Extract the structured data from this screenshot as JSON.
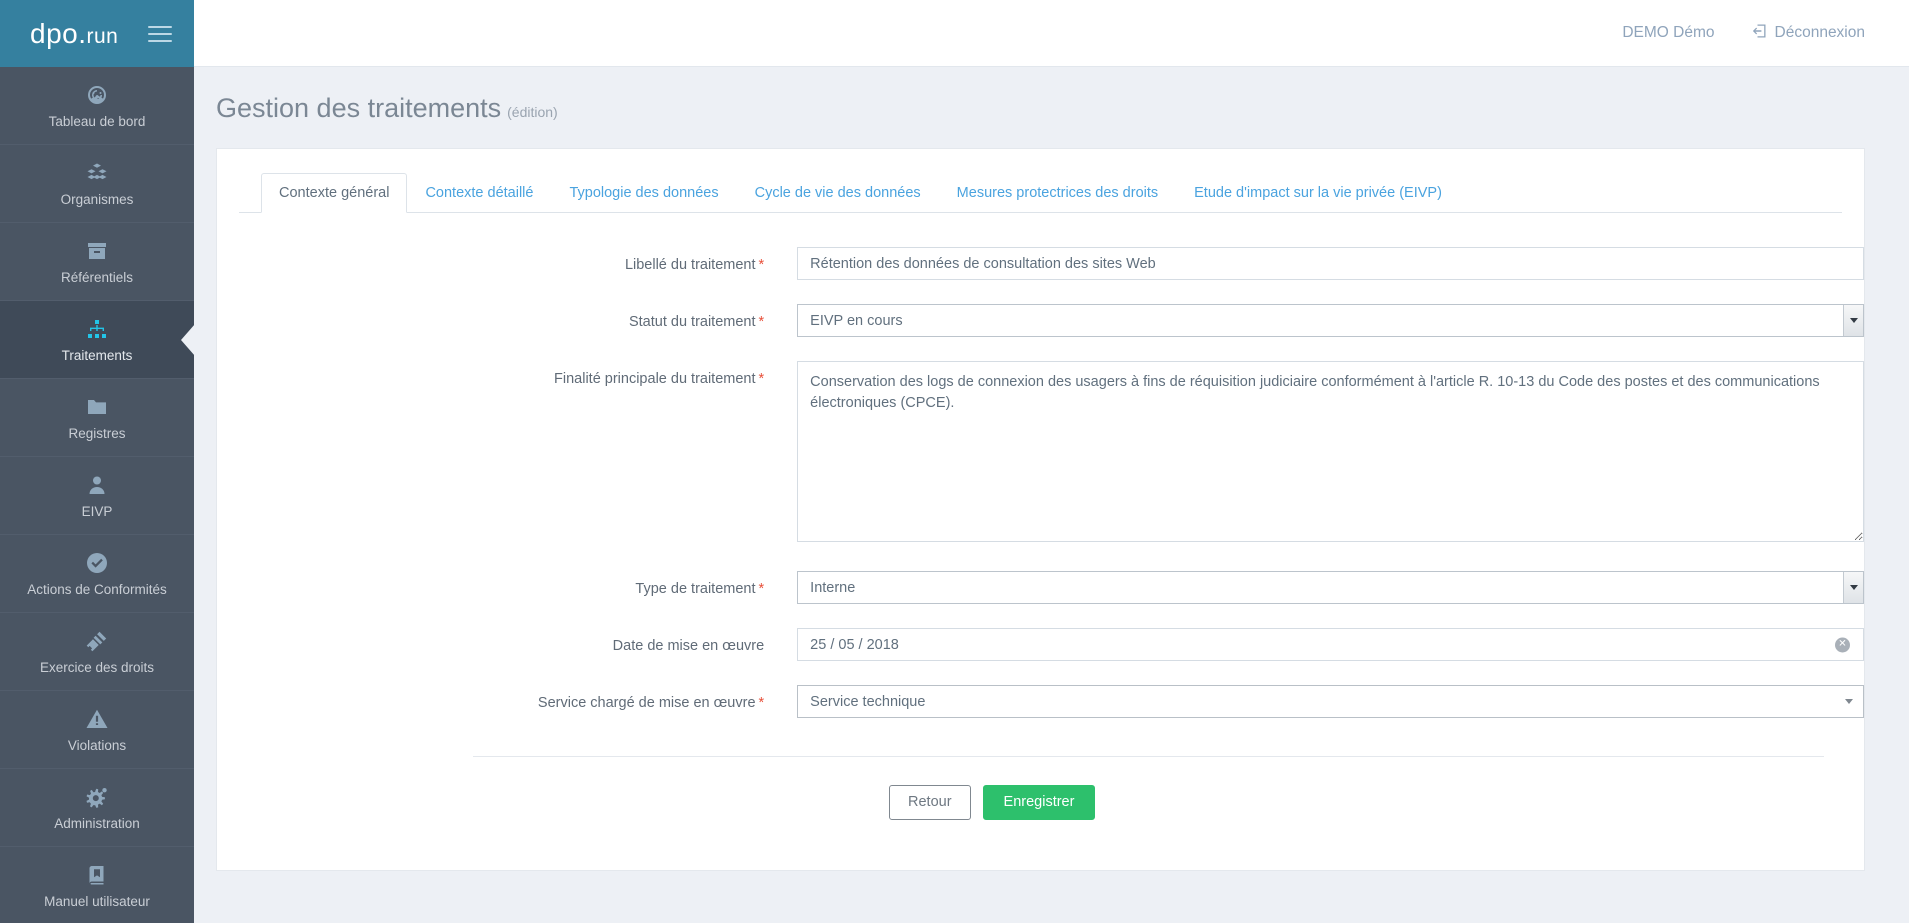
{
  "brand": {
    "name": "dpo",
    "dot": ".",
    "suffix": "run",
    "menu_icon": "hamburger-icon"
  },
  "topbar": {
    "user_name": "DEMO Démo",
    "logout_label": "Déconnexion",
    "logout_icon": "sign-out-icon"
  },
  "sidebar": {
    "items": [
      {
        "label": "Tableau de bord",
        "icon": "dashboard-gauge-icon",
        "active": false
      },
      {
        "label": "Organismes",
        "icon": "cubes-icon",
        "active": false
      },
      {
        "label": "Référentiels",
        "icon": "archive-box-icon",
        "active": false
      },
      {
        "label": "Traitements",
        "icon": "sitemap-icon",
        "active": true
      },
      {
        "label": "Registres",
        "icon": "folder-icon",
        "active": false
      },
      {
        "label": "EIVP",
        "icon": "user-icon",
        "active": false
      },
      {
        "label": "Actions de Conformités",
        "icon": "check-circle-icon",
        "active": false
      },
      {
        "label": "Exercice des droits",
        "icon": "gavel-icon",
        "active": false
      },
      {
        "label": "Violations",
        "icon": "warning-triangle-icon",
        "active": false
      },
      {
        "label": "Administration",
        "icon": "gears-icon",
        "active": false
      },
      {
        "label": "Manuel utilisateur",
        "icon": "book-icon",
        "active": false
      }
    ]
  },
  "page": {
    "title": "Gestion des traitements",
    "subtitle": "(édition)"
  },
  "tabs": [
    {
      "label": "Contexte général",
      "active": true
    },
    {
      "label": "Contexte détaillé",
      "active": false
    },
    {
      "label": "Typologie des données",
      "active": false
    },
    {
      "label": "Cycle de vie des données",
      "active": false
    },
    {
      "label": "Mesures protectrices des droits",
      "active": false
    },
    {
      "label": "Etude d'impact sur la vie privée (EIVP)",
      "active": false
    }
  ],
  "form": {
    "libelle": {
      "label": "Libellé du traitement",
      "required": true,
      "value": "Rétention des données de consultation des sites Web",
      "placeholder": ""
    },
    "statut": {
      "label": "Statut du traitement",
      "required": true,
      "value": "EIVP en cours"
    },
    "finalite": {
      "label": "Finalité principale du traitement",
      "required": true,
      "value": "Conservation des logs de connexion des usagers à fins de réquisition judiciaire conformément à l'article R. 10-13 du Code des postes et des communications électroniques (CPCE).",
      "placeholder": ""
    },
    "type": {
      "label": "Type de traitement",
      "required": true,
      "value": "Interne"
    },
    "date_mise_en_oeuvre": {
      "label": "Date de mise en œuvre",
      "required": false,
      "value": "25 / 05 / 2018",
      "clear_icon": "clear-circle-x-icon"
    },
    "service": {
      "label": "Service chargé de mise en œuvre",
      "required": true,
      "value": "Service technique",
      "caret_icon": "chevron-down-icon"
    }
  },
  "actions": {
    "back_label": "Retour",
    "save_label": "Enregistrer"
  },
  "colors": {
    "brand_blue": "#35809f",
    "sidebar": "#4a5563",
    "sidebar_active": "#3f4a58",
    "active_icon": "#22c5e8",
    "link_blue": "#4aa3df",
    "success_green": "#2dc06c",
    "required_red": "#e8503a",
    "page_bg": "#edf0f5"
  }
}
